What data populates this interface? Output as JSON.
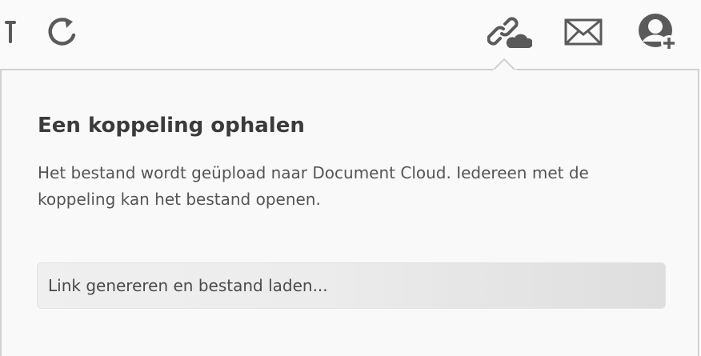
{
  "toolbar": {
    "icons": [
      "partial-tool-icon",
      "rotate-icon",
      "share-link-cloud-icon",
      "email-icon",
      "add-user-icon"
    ]
  },
  "popover": {
    "title": "Een koppeling ophalen",
    "description": "Het bestand wordt geüpload naar Document Cloud. Iedereen met de koppeling kan het bestand openen.",
    "progress_label": "Link genereren en bestand laden..."
  },
  "colors": {
    "toolbar_bg": "#fafafa",
    "popover_bg": "#f9f9f9",
    "icon": "#5a5a5a",
    "title": "#3b3b3b",
    "text": "#555555"
  }
}
